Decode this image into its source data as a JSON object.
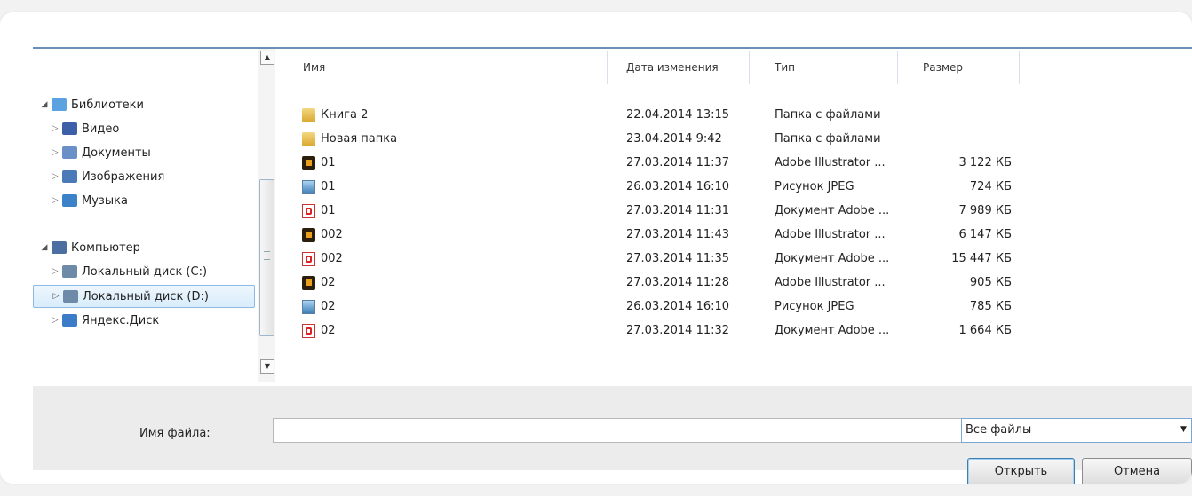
{
  "nav": {
    "items": [
      {
        "label": "Библиотеки",
        "arrow": "◢",
        "icon": "libraries-icon",
        "color": "#5aa3e0"
      },
      {
        "label": "Видео",
        "arrow": "▷",
        "icon": "video-icon",
        "color": "#3c5fa8"
      },
      {
        "label": "Документы",
        "arrow": "▷",
        "icon": "documents-icon",
        "color": "#6b8fc7"
      },
      {
        "label": "Изображения",
        "arrow": "▷",
        "icon": "pictures-icon",
        "color": "#4a7ab8"
      },
      {
        "label": "Музыка",
        "arrow": "▷",
        "icon": "music-icon",
        "color": "#3b82c8"
      },
      {
        "label": "Компьютер",
        "arrow": "◢",
        "icon": "computer-icon",
        "color": "#4a6fa0"
      },
      {
        "label": "Локальный диск (C:)",
        "arrow": "▷",
        "icon": "drive-c-icon",
        "color": "#6d8aa8"
      },
      {
        "label": "Локальный диск (D:)",
        "arrow": "▷",
        "icon": "drive-d-icon",
        "color": "#6d8aa8",
        "selected": true
      },
      {
        "label": "Яндекс.Диск",
        "arrow": "▷",
        "icon": "yandex-disk-icon",
        "color": "#3b7bc8"
      }
    ]
  },
  "columns": {
    "name": "Имя",
    "date": "Дата изменения",
    "type": "Тип",
    "size": "Размер"
  },
  "files": [
    {
      "name": "Книга 2",
      "date": "22.04.2014 13:15",
      "type": "Папка с файлами",
      "size": "",
      "kind": "folder"
    },
    {
      "name": "Новая папка",
      "date": "23.04.2014 9:42",
      "type": "Папка с файлами",
      "size": "",
      "kind": "folder"
    },
    {
      "name": "01",
      "date": "27.03.2014 11:37",
      "type": "Adobe Illustrator ...",
      "size": "3 122 КБ",
      "kind": "ai"
    },
    {
      "name": "01",
      "date": "26.03.2014 16:10",
      "type": "Рисунок JPEG",
      "size": "724 КБ",
      "kind": "jpg"
    },
    {
      "name": "01",
      "date": "27.03.2014 11:31",
      "type": "Документ Adobe ...",
      "size": "7 989 КБ",
      "kind": "pdf"
    },
    {
      "name": "002",
      "date": "27.03.2014 11:43",
      "type": "Adobe Illustrator ...",
      "size": "6 147 КБ",
      "kind": "ai"
    },
    {
      "name": "002",
      "date": "27.03.2014 11:35",
      "type": "Документ Adobe ...",
      "size": "15 447 КБ",
      "kind": "pdf"
    },
    {
      "name": "02",
      "date": "27.03.2014 11:28",
      "type": "Adobe Illustrator ...",
      "size": "905 КБ",
      "kind": "ai"
    },
    {
      "name": "02",
      "date": "26.03.2014 16:10",
      "type": "Рисунок JPEG",
      "size": "785 КБ",
      "kind": "jpg"
    },
    {
      "name": "02",
      "date": "27.03.2014 11:32",
      "type": "Документ Adobe ...",
      "size": "1 664 КБ",
      "kind": "pdf"
    }
  ],
  "footer": {
    "filename_label": "Имя файла:",
    "filename_value": "",
    "filter_label": "Все файлы",
    "open_label": "Открыть",
    "cancel_label": "Отмена"
  },
  "scroll": {
    "up": "▲",
    "down": "▼",
    "drop": "▼"
  }
}
